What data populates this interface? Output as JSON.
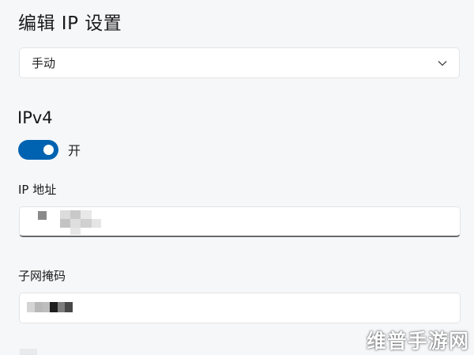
{
  "dialog": {
    "title": "编辑 IP 设置"
  },
  "mode_select": {
    "value": "手动",
    "icon": "chevron-down-icon"
  },
  "ipv4": {
    "heading": "IPv4",
    "toggle_state_label": "开",
    "toggle_on": true,
    "accent_color": "#0063b1"
  },
  "fields": {
    "ip_address_label": "IP 地址",
    "subnet_mask_label": "子网掩码"
  },
  "watermark": {
    "text": "维普手游网"
  }
}
